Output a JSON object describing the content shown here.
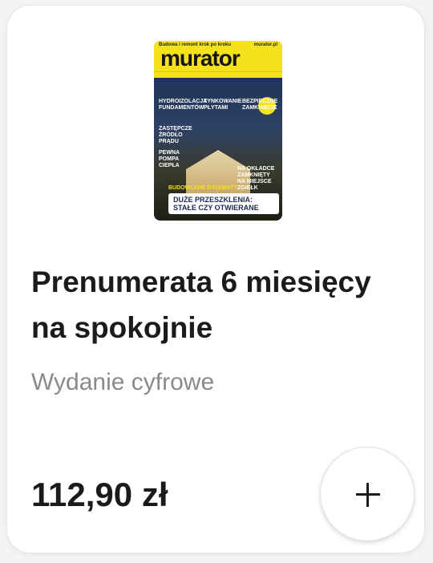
{
  "product": {
    "cover": {
      "tagline": "Budowa i remont krok po kroku",
      "site": "murator.pl",
      "logo": "murator",
      "headlines": [
        "Hydroizolacja fundamentów",
        "Tynkowanie płytami",
        "Bezpieczne zamknięcie",
        "Zastępcze źródło prądu",
        "Pewna pompa ciepła",
        "Na okładce zamknięty na miejsce zgiełk"
      ],
      "banner_kicker": "Budowlane dylematy",
      "banner_line1": "Duże przeszklenia:",
      "banner_line2": "stałe czy otwierane"
    },
    "title": "Prenumerata 6 miesięcy na spokojnie",
    "subtitle": "Wydanie cyfrowe",
    "price": "112,90 zł",
    "add_icon": "plus-icon"
  }
}
